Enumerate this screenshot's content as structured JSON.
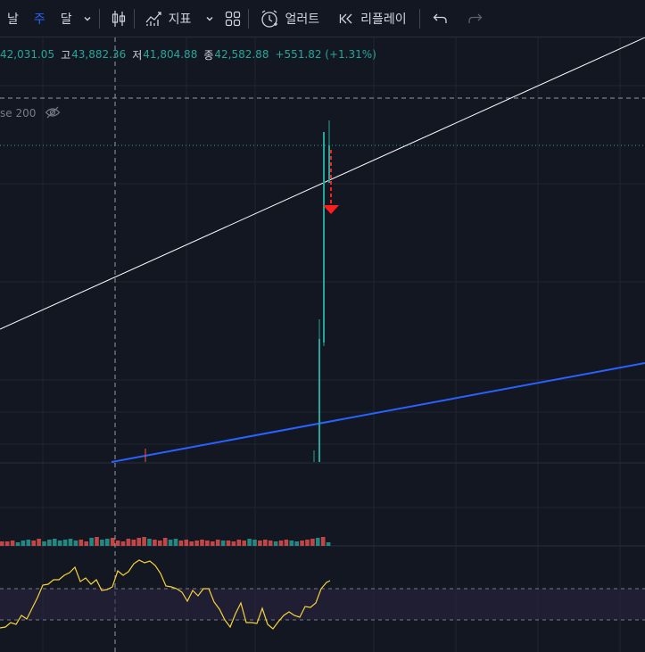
{
  "toolbar": {
    "intervals": [
      "날",
      "주",
      "달"
    ],
    "active_interval": "주",
    "indicators_label": "지표",
    "alert_label": "얼러트",
    "replay_label": "리플레이"
  },
  "legend": {
    "open_value": "42,031.05",
    "high_label": "고",
    "high_value": "43,882.36",
    "low_label": "저",
    "low_value": "41,804.88",
    "close_label": "종",
    "close_value": "42,582.88",
    "change": "+551.82 (+1.31%)",
    "ma_label": "se 200"
  },
  "colors": {
    "background": "#131722",
    "up": "#26a69a",
    "down": "#ef5350",
    "trendline": "#ffffff",
    "channel_line": "#2962ff",
    "rsi_line": "#f7d33a",
    "arrow": "#ff1e1e"
  },
  "icons": [
    "chevron-down-icon",
    "candles-icon",
    "indicators-icon",
    "layout-grid-icon",
    "alert-clock-icon",
    "replay-icon",
    "undo-icon",
    "redo-icon",
    "eye-off-icon"
  ]
}
